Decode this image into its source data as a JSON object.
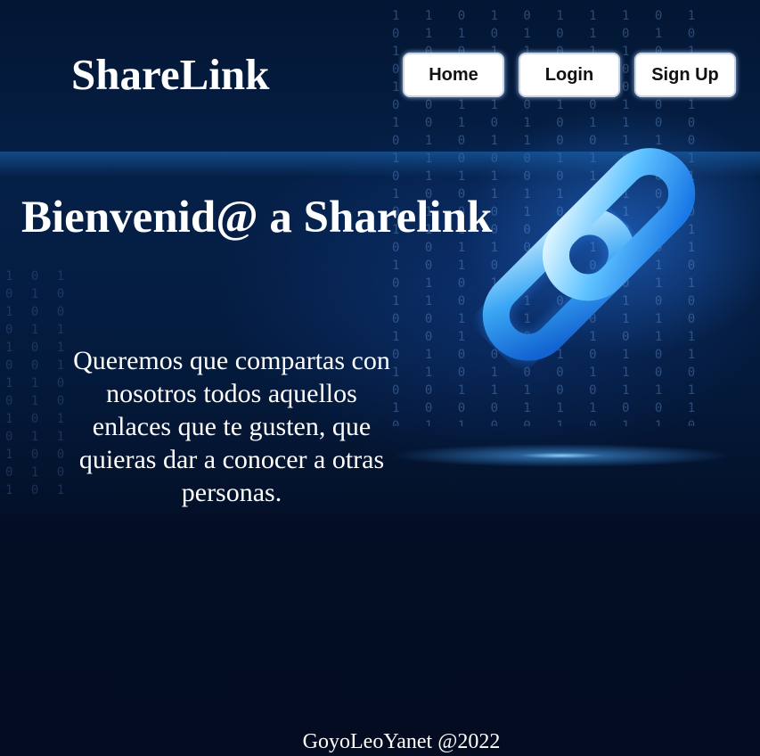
{
  "header": {
    "logo": "ShareLink",
    "nav": [
      {
        "label": "Home"
      },
      {
        "label": "Login"
      },
      {
        "label": "Sign Up"
      }
    ]
  },
  "hero": {
    "title": "Bienvenid@ a Sharelink",
    "intro": "Queremos que compartas con nosotros todos aquellos enlaces que te gusten, que quieras dar a conocer a otras personas.",
    "image_icon": "chain-link-icon"
  },
  "footer": {
    "text": "GoyoLeoYanet @2022"
  },
  "colors": {
    "background": "#03112a",
    "accent": "#3aa0ff",
    "text": "#ffffff",
    "button_bg": "#ffffff"
  }
}
